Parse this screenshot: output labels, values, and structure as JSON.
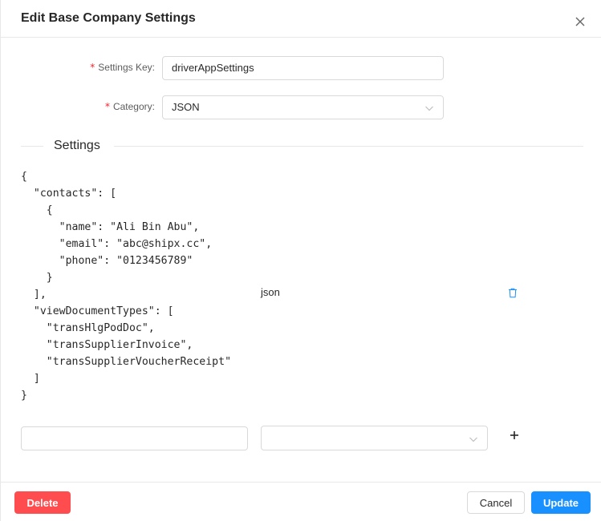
{
  "modal": {
    "title": "Edit Base Company Settings"
  },
  "form": {
    "settings_key": {
      "required_mark": "*",
      "label": "Settings Key",
      "colon": ":",
      "value": "driverAppSettings"
    },
    "category": {
      "required_mark": "*",
      "label": "Category",
      "colon": ":",
      "value": "JSON"
    }
  },
  "settings_section": {
    "title": "Settings",
    "json_text": "{\n  \"contacts\": [\n    {\n      \"name\": \"Ali Bin Abu\",\n      \"email\": \"abc@shipx.cc\",\n      \"phone\": \"0123456789\"\n    }\n  ],\n  \"viewDocumentTypes\": [\n    \"transHlgPodDoc\",\n    \"transSupplierInvoice\",\n    \"transSupplierVoucherReceipt\"\n  ]\n}",
    "type_label": "json",
    "new_key_value": "",
    "new_type_value": ""
  },
  "footer": {
    "delete_label": "Delete",
    "cancel_label": "Cancel",
    "update_label": "Update"
  },
  "icons": {
    "close": "close-icon",
    "select_arrow": "chevron-down-icon",
    "trash": "trash-icon",
    "plus": "plus-icon"
  },
  "colors": {
    "primary": "#1890ff",
    "danger": "#ff4d4f",
    "required": "#f5222d",
    "border": "#d9d9d9"
  }
}
